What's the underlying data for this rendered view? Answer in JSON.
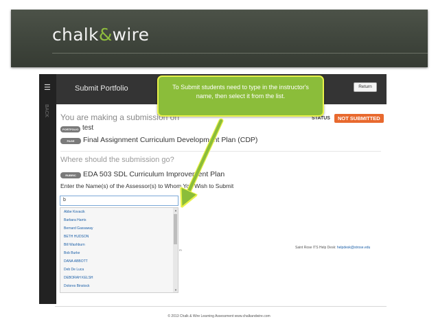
{
  "brand": {
    "logo_left": "chalk",
    "logo_amp": "&",
    "logo_right": "wire"
  },
  "app": {
    "menu_icon": "hamburger-icon",
    "side_label": "BACK",
    "title": "Submit Portfolio",
    "return_label": "Return"
  },
  "submission": {
    "making_text": "You are making a submission on",
    "status_label": "STATUS",
    "status_value": "NOT SUBMITTED",
    "status_color": "#e8692e",
    "portfolio_tag": "PORTFOLIO",
    "portfolio_value": "test",
    "page_tag": "PAGE",
    "page_value": "Final Assignment Curriculum Development Plan (CDP)",
    "where_heading": "Where should the submission go?",
    "rubric_tag": "RUBRIC",
    "rubric_value": "EDA 503 SDL Curriculum Improvement Plan",
    "assessor_label": "Enter the Name(s) of the Assessor(s) to Whom You Wish to Submit",
    "assessor_input_value": "b",
    "suggestions": [
      "Abbe Kovacik",
      "Barbara Harris",
      "Bernard Gassaway",
      "BETH HUDSON",
      "Bill Washburn",
      "Bob Burke",
      "DANA ABBOTT",
      "Deb De Luca",
      "DEBORAH KELSH",
      "Dolores Binstock"
    ],
    "peek_text": "m",
    "help_text": "Saint Rose ITS Help Desk: ",
    "help_email": "helpdesk@strose.edu"
  },
  "callout": {
    "text": "To Submit students need to type in the instructor's name, then select it from the list.",
    "bg_color": "#8bbd3a",
    "border_color": "#e9f24a"
  },
  "footer": {
    "text": "© 2013 Chalk & Wire Learning Assessment   www.chalkandwire.com"
  }
}
